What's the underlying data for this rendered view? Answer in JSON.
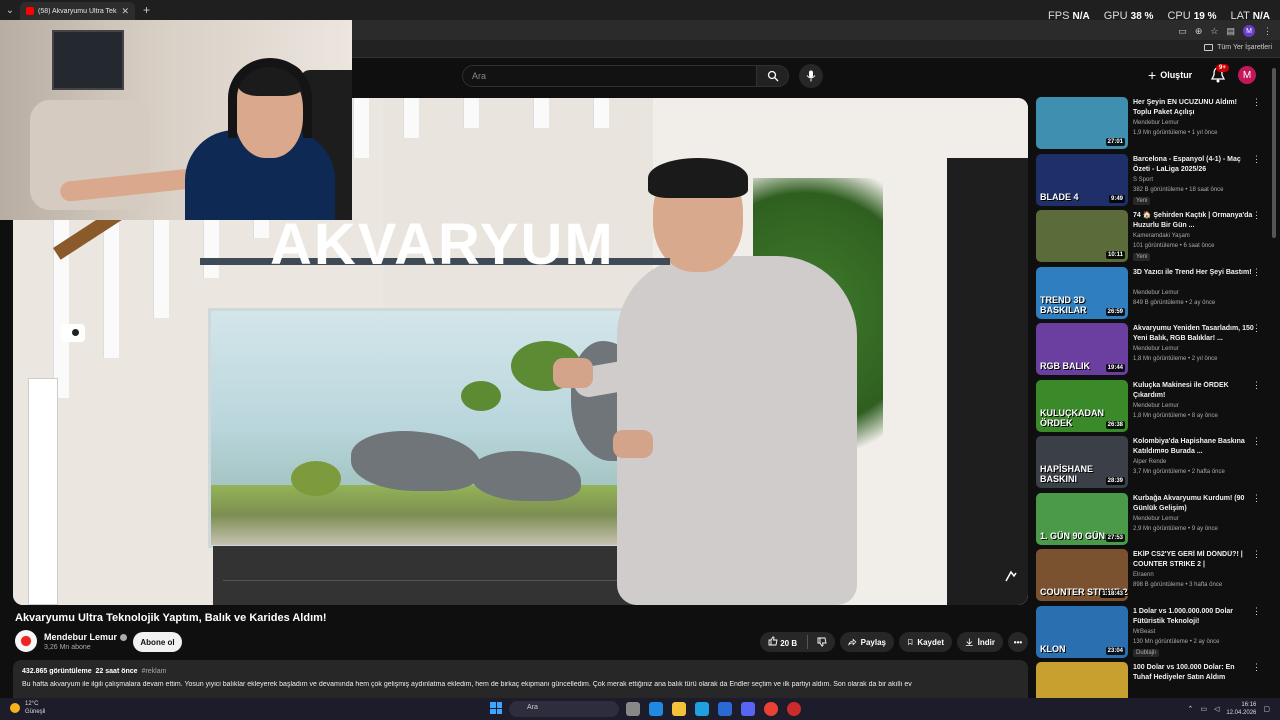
{
  "browser": {
    "tab_title": "(58) Akvaryumu Ultra Teknolojik",
    "tab_close": "✕",
    "new_tab": "+",
    "tab_menu": "⌄",
    "bookmarks_all": "Tüm Yer İşaretleri",
    "profile_letter": "M"
  },
  "overlay": {
    "fps_label": "FPS",
    "fps_value": "N/A",
    "gpu_label": "GPU",
    "gpu_value": "38 %",
    "cpu_label": "CPU",
    "cpu_value": "19 %",
    "lat_label": "LAT",
    "lat_value": "N/A"
  },
  "header": {
    "search_placeholder": "Ara",
    "create_label": "Oluştur",
    "notif_count": "9+",
    "avatar_letter": "M"
  },
  "video": {
    "thumbnail_title": "AKVARYUM",
    "title": "Akvaryumu Ultra Teknolojik Yaptım, Balık ve Karides Aldım!",
    "channel": "Mendebur Lemur",
    "subscribers": "3,26 Mn abone",
    "subscribe_label": "Abone ol",
    "likes": "20 B",
    "share_label": "Paylaş",
    "save_label": "Kaydet",
    "download_label": "İndir",
    "views": "432.865 görüntüleme",
    "published": "22 saat önce",
    "tag": "#reklam",
    "description": "Bu hafta akvaryum ile ilgili çalışmalara devam ettim. Yosun yiyici balıklar ekleyerek başladım ve devamında hem çok gelişmiş aydınlatma ekledim, hem de birkaç ekipmanı güncelledim. Çok merak ettiğiniz ana balık türü olarak da Endler seçtim ve ilk partiyi aldım. Son olarak da bir akıllı ev"
  },
  "recommendations": [
    {
      "title": "Her Şeyin EN UCUZUNU Aldım! Toplu Paket Açılışı",
      "channel": "Mendebur Lemur",
      "meta": "1,9 Mn görüntüleme • 1 yıl önce",
      "duration": "27:01",
      "badge": "",
      "color": "#3f8fb0",
      "overlay": ""
    },
    {
      "title": "Barcelona - Espanyol (4-1) - Maç Özeti - LaLiga 2025/26",
      "channel": "S Sport",
      "meta": "382 B görüntüleme • 18 saat önce",
      "duration": "9:49",
      "badge": "Yeni",
      "color": "#1e2f6a",
      "overlay": "BLADE 4"
    },
    {
      "title": "74 🏠 Şehirden Kaçtık | Ormanya'da Huzurlu Bir Gün ...",
      "channel": "Kameramdaki Yaşam",
      "meta": "101 görüntüleme • 6 saat önce",
      "duration": "10:11",
      "badge": "Yeni",
      "color": "#5b6b3a",
      "overlay": ""
    },
    {
      "title": "3D Yazıcı ile Trend Her Şeyi Bastım!",
      "channel": "Mendebur Lemur",
      "meta": "849 B görüntüleme • 2 ay önce",
      "duration": "26:59",
      "badge": "",
      "color": "#2f7fc0",
      "overlay": "TREND 3D BASKILAR"
    },
    {
      "title": "Akvaryumu Yeniden Tasarladım, 150 Yeni Balık, RGB Balıklar! ...",
      "channel": "Mendebur Lemur",
      "meta": "1,8 Mn görüntüleme • 2 yıl önce",
      "duration": "19:44",
      "badge": "",
      "color": "#6a3fa0",
      "overlay": "RGB BALIK"
    },
    {
      "title": "Kuluçka Makinesi ile ÖRDEK Çıkardım!",
      "channel": "Mendebur Lemur",
      "meta": "1,8 Mn görüntüleme • 8 ay önce",
      "duration": "26:38",
      "badge": "",
      "color": "#3a8a2a",
      "overlay": "KULUÇKADAN ÖRDEK"
    },
    {
      "title": "Kolombiya'da Hapishane Baskına Katıldım¤o Burada ...",
      "channel": "Alper Rende",
      "meta": "3,7 Mn görüntüleme • 2 hafta önce",
      "duration": "28:39",
      "badge": "",
      "color": "#3a3f48",
      "overlay": "HAPİSHANE BASKINI"
    },
    {
      "title": "Kurbağa Akvaryumu Kurdum! (90 Günlük Gelişim)",
      "channel": "Mendebur Lemur",
      "meta": "2,9 Mn görüntüleme • 9 ay önce",
      "duration": "27:53",
      "badge": "",
      "color": "#4a9a4a",
      "overlay": "1. GÜN  90 GÜN"
    },
    {
      "title": "EKİP CS2'YE GERİ Mİ DÖNDÜ?! | COUNTER STRIKE 2 |",
      "channel": "Elraenn",
      "meta": "898 B görüntüleme • 3 hafta önce",
      "duration": "1:18:43",
      "badge": "",
      "color": "#7a5230",
      "overlay": "COUNTER STRIKE 2"
    },
    {
      "title": "1 Dolar vs 1.000.000.000 Dolar Fütüristik Teknoloji!",
      "channel": "MrBeast",
      "meta": "130 Mn görüntüleme • 2 ay önce",
      "duration": "23:04",
      "badge": "Dublajlı",
      "color": "#2a6fb0",
      "overlay": "KLON"
    },
    {
      "title": "100 Dolar vs 100.000 Dolar: En Tuhaf Hediyeler Satın Aldım",
      "channel": "",
      "meta": "",
      "duration": "",
      "badge": "",
      "color": "#c8a030",
      "overlay": ""
    }
  ],
  "taskbar": {
    "weather_temp": "12°C",
    "weather_desc": "Güneşli",
    "search_label": "Ara",
    "time": "16:16",
    "date": "12.04.2026"
  }
}
